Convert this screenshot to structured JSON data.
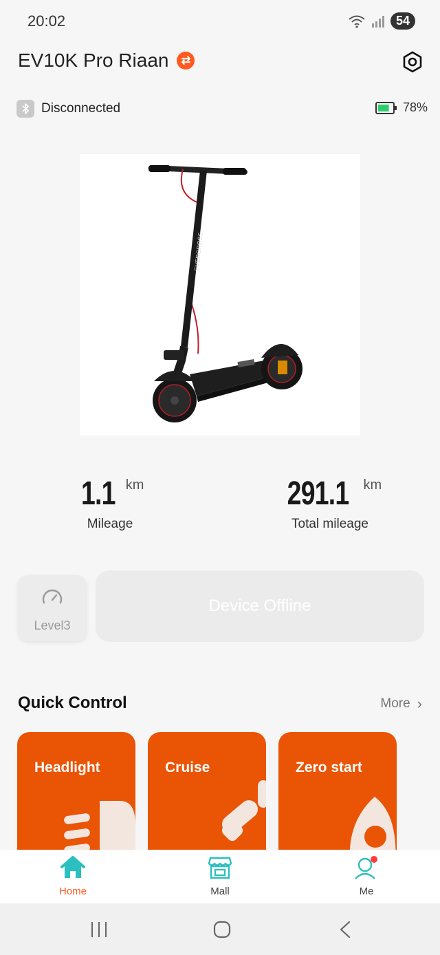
{
  "status_bar": {
    "time": "20:02",
    "battery": "54"
  },
  "header": {
    "device_name": "EV10K Pro Riaan"
  },
  "connection": {
    "status": "Disconnected",
    "battery_percent": "78%",
    "battery_level": 0.78
  },
  "product": {
    "brand_text": "EVERCROSS"
  },
  "stats": {
    "mileage": {
      "value": "1.1",
      "unit": "km",
      "label": "Mileage"
    },
    "total": {
      "value": "291.1",
      "unit": "km",
      "label": "Total mileage"
    }
  },
  "level": {
    "label": "Level3"
  },
  "offline": {
    "label": "Device Offline"
  },
  "quick_control": {
    "title": "Quick Control",
    "more": "More",
    "cards": [
      {
        "label": "Headlight",
        "icon": "headlight-icon"
      },
      {
        "label": "Cruise",
        "icon": "cruise-icon"
      },
      {
        "label": "Zero start",
        "icon": "rocket-icon"
      }
    ]
  },
  "tabs": [
    {
      "label": "Home",
      "icon": "home-icon",
      "active": true
    },
    {
      "label": "Mall",
      "icon": "store-icon",
      "active": false
    },
    {
      "label": "Me",
      "icon": "user-icon",
      "active": false
    }
  ],
  "colors": {
    "accent": "#ea5405",
    "tab_active": "#ff5a1f",
    "home_icon": "#2bbfbf"
  }
}
